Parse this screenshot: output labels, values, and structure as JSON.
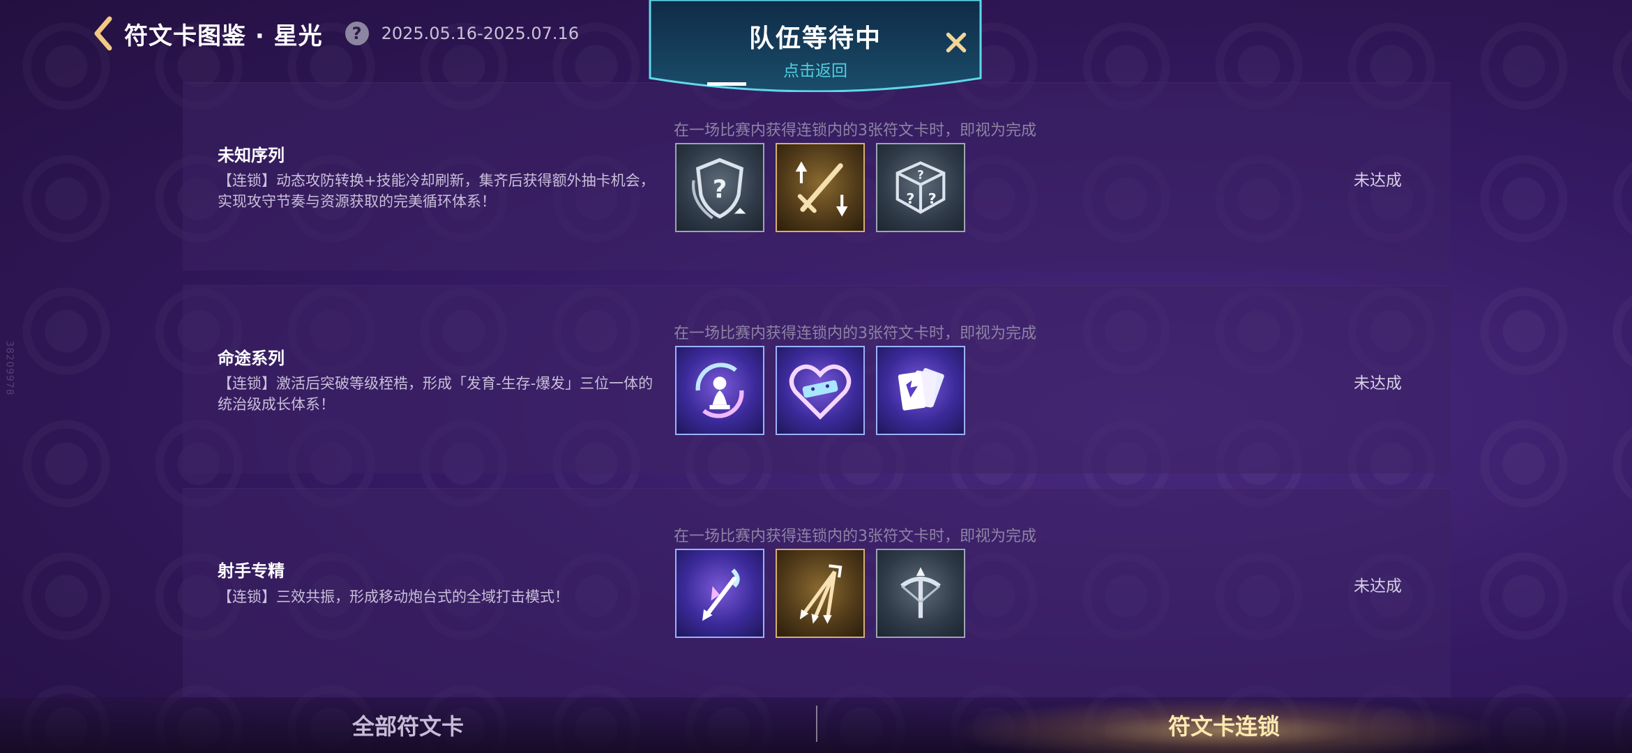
{
  "header": {
    "title": "符文卡图鉴 · 星光",
    "help": "?",
    "date_range": "2025.05.16-2025.07.16"
  },
  "side_id": "38209978",
  "overlay": {
    "title": "队伍等待中",
    "subtitle": "点击返回"
  },
  "rows": [
    {
      "name": "未知序列",
      "desc": "【连锁】动态攻防转换+技能冷却刷新，集齐后获得额外抽卡机会，实现攻守节奏与资源获取的完美循环体系！",
      "requirement": "在一场比赛内获得连锁内的3张符文卡时，即视为完成",
      "status": "未达成",
      "cards": [
        {
          "icon": "shield-question-icon",
          "tier": "silver"
        },
        {
          "icon": "sword-arrows-icon",
          "tier": "gold"
        },
        {
          "icon": "question-dice-icon",
          "tier": "silver"
        }
      ]
    },
    {
      "name": "命途系列",
      "desc": "【连锁】激活后突破等级桎梏，形成「发育-生存-爆发」三位一体的统治级成长体系！",
      "requirement": "在一场比赛内获得连锁内的3张符文卡时，即视为完成",
      "status": "未达成",
      "cards": [
        {
          "icon": "chess-pawn-icon",
          "tier": "holo"
        },
        {
          "icon": "heart-bandage-icon",
          "tier": "holo"
        },
        {
          "icon": "card-fan-icon",
          "tier": "holo"
        }
      ]
    },
    {
      "name": "射手专精",
      "desc": "【连锁】三效共振，形成移动炮台式的全域打击模式！",
      "requirement": "在一场比赛内获得连锁内的3张符文卡时，即视为完成",
      "status": "未达成",
      "cards": [
        {
          "icon": "arrow-strike-icon",
          "tier": "holo"
        },
        {
          "icon": "multi-arrow-icon",
          "tier": "gold"
        },
        {
          "icon": "crossbow-icon",
          "tier": "silver"
        }
      ]
    }
  ],
  "tabs": {
    "all": "全部符文卡",
    "chain": "符文卡连锁",
    "active": "chain"
  },
  "colors": {
    "accent_gold": "#ffe9b0",
    "accent_cyan": "#4fd0e0",
    "background": "#351a63"
  }
}
